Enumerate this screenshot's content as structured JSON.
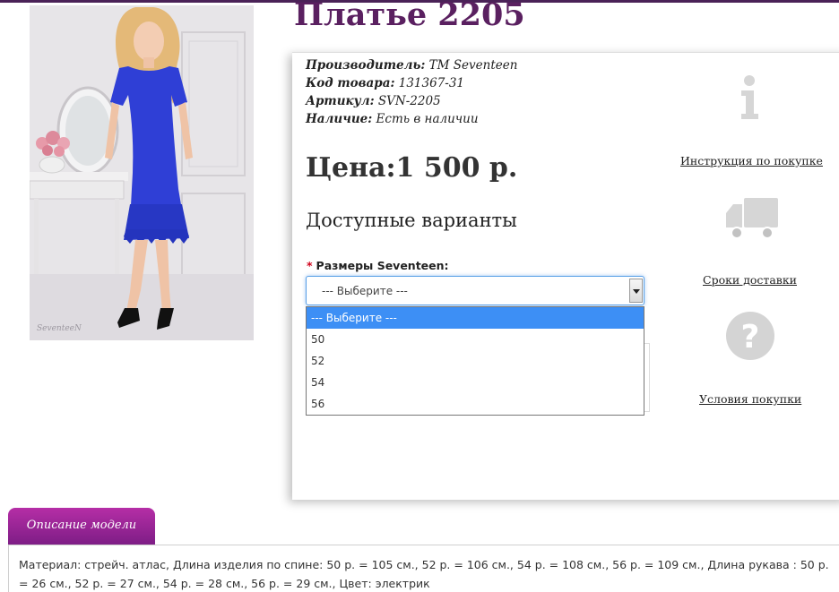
{
  "product": {
    "title": "Платье 2205",
    "specs": [
      {
        "key": "Производитель:",
        "value": "ТМ Seventeen"
      },
      {
        "key": "Код товара:",
        "value": "131367-31"
      },
      {
        "key": "Артикул:",
        "value": "SVN-2205"
      },
      {
        "key": "Наличие:",
        "value": "Есть в наличии"
      }
    ],
    "price": "Цена:1 500 р.",
    "variants_heading": "Доступные варианты"
  },
  "size_selector": {
    "required_mark": "*",
    "label": "Размеры Seventeen:",
    "selected": "--- Выберите ---",
    "options": [
      "--- Выберите ---",
      "50",
      "52",
      "54",
      "56"
    ],
    "highlighted_option": "--- Выберите ---"
  },
  "side_links": {
    "instruction": "Инструкция по покупке",
    "delivery": "Сроки доставки",
    "conditions": "Условия покупки"
  },
  "photo": {
    "watermark": "SeventeeN"
  },
  "tabs": {
    "description_tab": "Описание модели"
  },
  "description": {
    "text": "Материал: стрейч. атлас, Длина изделия по спине: 50 р. = 105 см., 52 р. = 106 см., 54 р. = 108 см., 56 р. = 109 см., Длина рукава : 50 р. = 26 см., 52 р. = 27 см., 54 р. = 28 см., 56 р. = 29 см., Цвет: электрик"
  },
  "colors": {
    "title": "#5a2060",
    "tab_gradient_top": "#b52ea6",
    "tab_gradient_bottom": "#7e1d86",
    "dropdown_highlight": "#3d8ff5",
    "dress": "#2f3fd6"
  },
  "icons": [
    "info-icon",
    "truck-icon",
    "question-icon",
    "chevron-down-icon"
  ]
}
